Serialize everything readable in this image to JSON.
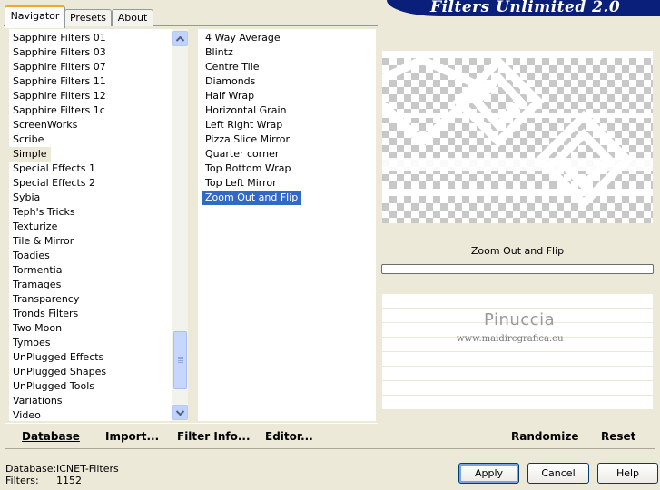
{
  "tabs": [
    "Navigator",
    "Presets",
    "About"
  ],
  "banner_title": "Filters Unlimited 2.0",
  "categories": [
    "Sapphire Filters 01",
    "Sapphire Filters 03",
    "Sapphire Filters 07",
    "Sapphire Filters 11",
    "Sapphire Filters 12",
    "Sapphire Filters 1c",
    "ScreenWorks",
    "Scribe",
    "Simple",
    "Special Effects 1",
    "Special Effects 2",
    "Sybia",
    "Teph's Tricks",
    "Texturize",
    "Tile & Mirror",
    "Toadies",
    "Tormentia",
    "Tramages",
    "Transparency",
    "Tronds Filters",
    "Two Moon",
    "Tymoes",
    "UnPlugged Effects",
    "UnPlugged Shapes",
    "UnPlugged Tools",
    "Variations",
    "Video"
  ],
  "selected_category": "Simple",
  "filters": [
    "4 Way Average",
    "Blintz",
    "Centre Tile",
    "Diamonds",
    "Half Wrap",
    "Horizontal Grain",
    "Left Right Wrap",
    "Pizza Slice Mirror",
    "Quarter corner",
    "Top Bottom Wrap",
    "Top Left Mirror",
    "Zoom Out and Flip"
  ],
  "selected_filter": "Zoom Out and Flip",
  "preview_caption": "Zoom Out and Flip",
  "watermark": {
    "name": "Pinuccia",
    "site": "www.maidiregrafica.eu"
  },
  "toolbar": {
    "database": "Database",
    "import": "Import...",
    "filter_info": "Filter Info...",
    "editor": "Editor...",
    "randomize": "Randomize",
    "reset": "Reset"
  },
  "status": {
    "database_label": "Database:",
    "database_value": "ICNET-Filters",
    "filters_label": "Filters:",
    "filters_value": "1152"
  },
  "buttons": {
    "apply": "Apply",
    "cancel": "Cancel",
    "help": "Help"
  },
  "colors": {
    "banner": "#0a1f7a",
    "selection": "#316ac5",
    "window": "#ece9d8"
  }
}
